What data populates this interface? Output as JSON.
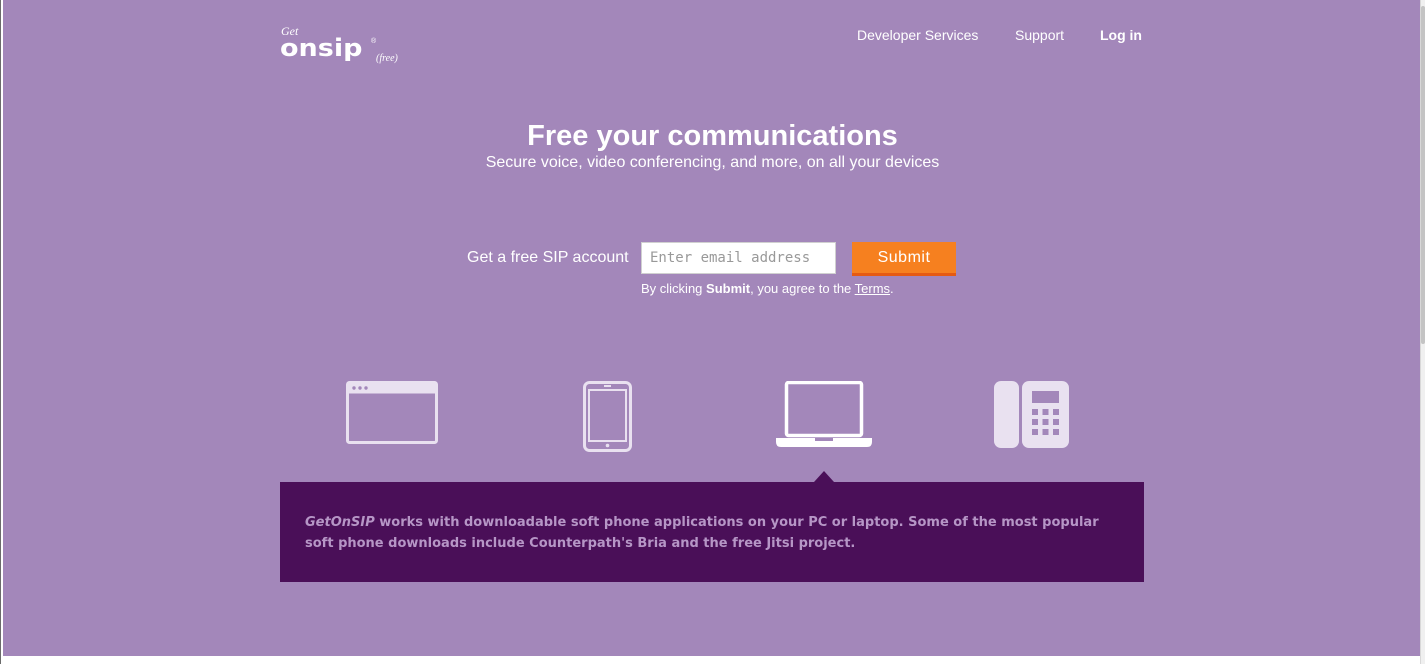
{
  "colors": {
    "background": "#a387ba",
    "info_panel": "#4a0f58",
    "info_text": "#b696c6",
    "submit_button": "#f6801f",
    "icon_fill": "#e9e1f0"
  },
  "logo": {
    "prefix": "Get",
    "wordmark": "onsip",
    "registered": "®",
    "suffix": "(free)"
  },
  "nav": {
    "developer_services": "Developer Services",
    "support": "Support",
    "login": "Log in"
  },
  "hero": {
    "title": "Free your communications",
    "subtitle": "Secure voice, video conferencing, and more, on all your devices"
  },
  "signup": {
    "label": "Get a free SIP account",
    "email_placeholder": "Enter email address",
    "email_value": "",
    "submit_label": "Submit",
    "terms_prefix": "By clicking ",
    "terms_bold": "Submit",
    "terms_middle": ", you agree to the ",
    "terms_link": "Terms",
    "terms_suffix": "."
  },
  "devices": [
    {
      "icon": "browser-window-icon"
    },
    {
      "icon": "tablet-icon"
    },
    {
      "icon": "laptop-icon",
      "selected": true
    },
    {
      "icon": "desk-phone-icon"
    }
  ],
  "info": {
    "brand": "GetOnSIP",
    "text": " works with downloadable soft phone applications on your PC or laptop. Some of the most popular soft phone downloads include Counterpath's Bria and the free Jitsi project."
  }
}
